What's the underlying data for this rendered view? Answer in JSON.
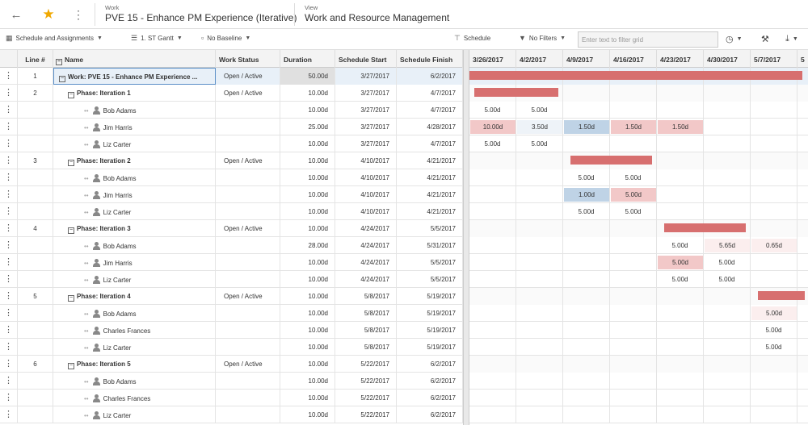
{
  "header": {
    "work_label": "Work",
    "work_title": "PVE 15 - Enhance PM Experience (Iterative)",
    "view_label": "View",
    "view_title": "Work and Resource Management"
  },
  "toolbar": {
    "schedule_assignments": "Schedule and Assignments",
    "gantt": "1. ST Gantt",
    "baseline": "No Baseline",
    "schedule": "Schedule",
    "filters": "No Filters",
    "filter_placeholder": "Enter text to filter grid"
  },
  "columns": {
    "line": "Line #",
    "name": "Name",
    "status": "Work Status",
    "duration": "Duration",
    "start": "Schedule Start",
    "finish": "Schedule Finish"
  },
  "weeks": [
    "3/26/2017",
    "4/2/2017",
    "4/9/2017",
    "4/16/2017",
    "4/23/2017",
    "4/30/2017",
    "5/7/2017",
    "5"
  ],
  "colors": {
    "bar": "#d76f6f",
    "over": "#f2c8c8",
    "under": "#bfd3e6",
    "light_pink": "#fbeeee",
    "light_blue": "#eef3f8"
  },
  "rows": [
    {
      "line": "1",
      "name": "Work: PVE 15 - Enhance PM Experience ...",
      "type": "work",
      "status": "Open / Active",
      "duration": "50.00d",
      "start": "3/27/2017",
      "finish": "6/2/2017",
      "bar": {
        "start_week": 0,
        "span_weeks": 7.1
      },
      "cells": []
    },
    {
      "line": "2",
      "name": "Phase: Iteration 1",
      "type": "phase",
      "status": "Open / Active",
      "duration": "10.00d",
      "start": "3/27/2017",
      "finish": "4/7/2017",
      "bar": {
        "start_week": 0.1,
        "span_weeks": 1.8
      },
      "cells": []
    },
    {
      "line": "",
      "name": "Bob Adams",
      "type": "resource",
      "status": "",
      "duration": "10.00d",
      "start": "3/27/2017",
      "finish": "4/7/2017",
      "cells": [
        {
          "col": 0,
          "val": "5.00d"
        },
        {
          "col": 1,
          "val": "5.00d"
        }
      ]
    },
    {
      "line": "",
      "name": "Jim Harris",
      "type": "resource",
      "status": "",
      "duration": "25.00d",
      "start": "3/27/2017",
      "finish": "4/28/2017",
      "cells": [
        {
          "col": 0,
          "val": "10.00d",
          "hl": "over"
        },
        {
          "col": 1,
          "val": "3.50d",
          "hl": "light_blue"
        },
        {
          "col": 2,
          "val": "1.50d",
          "hl": "under"
        },
        {
          "col": 3,
          "val": "1.50d",
          "hl": "over"
        },
        {
          "col": 4,
          "val": "1.50d",
          "hl": "over"
        }
      ]
    },
    {
      "line": "",
      "name": "Liz Carter",
      "type": "resource",
      "status": "",
      "duration": "10.00d",
      "start": "3/27/2017",
      "finish": "4/7/2017",
      "cells": [
        {
          "col": 0,
          "val": "5.00d"
        },
        {
          "col": 1,
          "val": "5.00d"
        }
      ]
    },
    {
      "line": "3",
      "name": "Phase: Iteration 2",
      "type": "phase",
      "status": "Open / Active",
      "duration": "10.00d",
      "start": "4/10/2017",
      "finish": "4/21/2017",
      "bar": {
        "start_week": 2.15,
        "span_weeks": 1.75
      },
      "cells": []
    },
    {
      "line": "",
      "name": "Bob Adams",
      "type": "resource",
      "status": "",
      "duration": "10.00d",
      "start": "4/10/2017",
      "finish": "4/21/2017",
      "cells": [
        {
          "col": 2,
          "val": "5.00d"
        },
        {
          "col": 3,
          "val": "5.00d"
        }
      ]
    },
    {
      "line": "",
      "name": "Jim Harris",
      "type": "resource",
      "status": "",
      "duration": "10.00d",
      "start": "4/10/2017",
      "finish": "4/21/2017",
      "cells": [
        {
          "col": 2,
          "val": "1.00d",
          "hl": "under"
        },
        {
          "col": 3,
          "val": "5.00d",
          "hl": "over"
        }
      ]
    },
    {
      "line": "",
      "name": "Liz Carter",
      "type": "resource",
      "status": "",
      "duration": "10.00d",
      "start": "4/10/2017",
      "finish": "4/21/2017",
      "cells": [
        {
          "col": 2,
          "val": "5.00d"
        },
        {
          "col": 3,
          "val": "5.00d"
        }
      ]
    },
    {
      "line": "4",
      "name": "Phase: Iteration 3",
      "type": "phase",
      "status": "Open / Active",
      "duration": "10.00d",
      "start": "4/24/2017",
      "finish": "5/5/2017",
      "bar": {
        "start_week": 4.15,
        "span_weeks": 1.75
      },
      "cells": []
    },
    {
      "line": "",
      "name": "Bob Adams",
      "type": "resource",
      "status": "",
      "duration": "28.00d",
      "start": "4/24/2017",
      "finish": "5/31/2017",
      "cells": [
        {
          "col": 4,
          "val": "5.00d"
        },
        {
          "col": 5,
          "val": "5.65d",
          "hl": "light_pink"
        },
        {
          "col": 6,
          "val": "0.65d",
          "hl": "light_pink"
        }
      ]
    },
    {
      "line": "",
      "name": "Jim Harris",
      "type": "resource",
      "status": "",
      "duration": "10.00d",
      "start": "4/24/2017",
      "finish": "5/5/2017",
      "cells": [
        {
          "col": 4,
          "val": "5.00d",
          "hl": "over"
        },
        {
          "col": 5,
          "val": "5.00d"
        }
      ]
    },
    {
      "line": "",
      "name": "Liz Carter",
      "type": "resource",
      "status": "",
      "duration": "10.00d",
      "start": "4/24/2017",
      "finish": "5/5/2017",
      "cells": [
        {
          "col": 4,
          "val": "5.00d"
        },
        {
          "col": 5,
          "val": "5.00d"
        }
      ]
    },
    {
      "line": "5",
      "name": "Phase: Iteration 4",
      "type": "phase",
      "status": "Open / Active",
      "duration": "10.00d",
      "start": "5/8/2017",
      "finish": "5/19/2017",
      "bar": {
        "start_week": 6.15,
        "span_weeks": 1.0
      },
      "cells": []
    },
    {
      "line": "",
      "name": "Bob Adams",
      "type": "resource",
      "status": "",
      "duration": "10.00d",
      "start": "5/8/2017",
      "finish": "5/19/2017",
      "cells": [
        {
          "col": 6,
          "val": "5.00d",
          "hl": "light_pink"
        }
      ]
    },
    {
      "line": "",
      "name": "Charles Frances",
      "type": "resource",
      "status": "",
      "duration": "10.00d",
      "start": "5/8/2017",
      "finish": "5/19/2017",
      "cells": [
        {
          "col": 6,
          "val": "5.00d"
        }
      ]
    },
    {
      "line": "",
      "name": "Liz Carter",
      "type": "resource",
      "status": "",
      "duration": "10.00d",
      "start": "5/8/2017",
      "finish": "5/19/2017",
      "cells": [
        {
          "col": 6,
          "val": "5.00d"
        }
      ]
    },
    {
      "line": "6",
      "name": "Phase: Iteration 5",
      "type": "phase",
      "status": "Open / Active",
      "duration": "10.00d",
      "start": "5/22/2017",
      "finish": "6/2/2017",
      "cells": []
    },
    {
      "line": "",
      "name": "Bob Adams",
      "type": "resource",
      "status": "",
      "duration": "10.00d",
      "start": "5/22/2017",
      "finish": "6/2/2017",
      "cells": []
    },
    {
      "line": "",
      "name": "Charles Frances",
      "type": "resource",
      "status": "",
      "duration": "10.00d",
      "start": "5/22/2017",
      "finish": "6/2/2017",
      "cells": []
    },
    {
      "line": "",
      "name": "Liz Carter",
      "type": "resource",
      "status": "",
      "duration": "10.00d",
      "start": "5/22/2017",
      "finish": "6/2/2017",
      "cells": []
    }
  ]
}
